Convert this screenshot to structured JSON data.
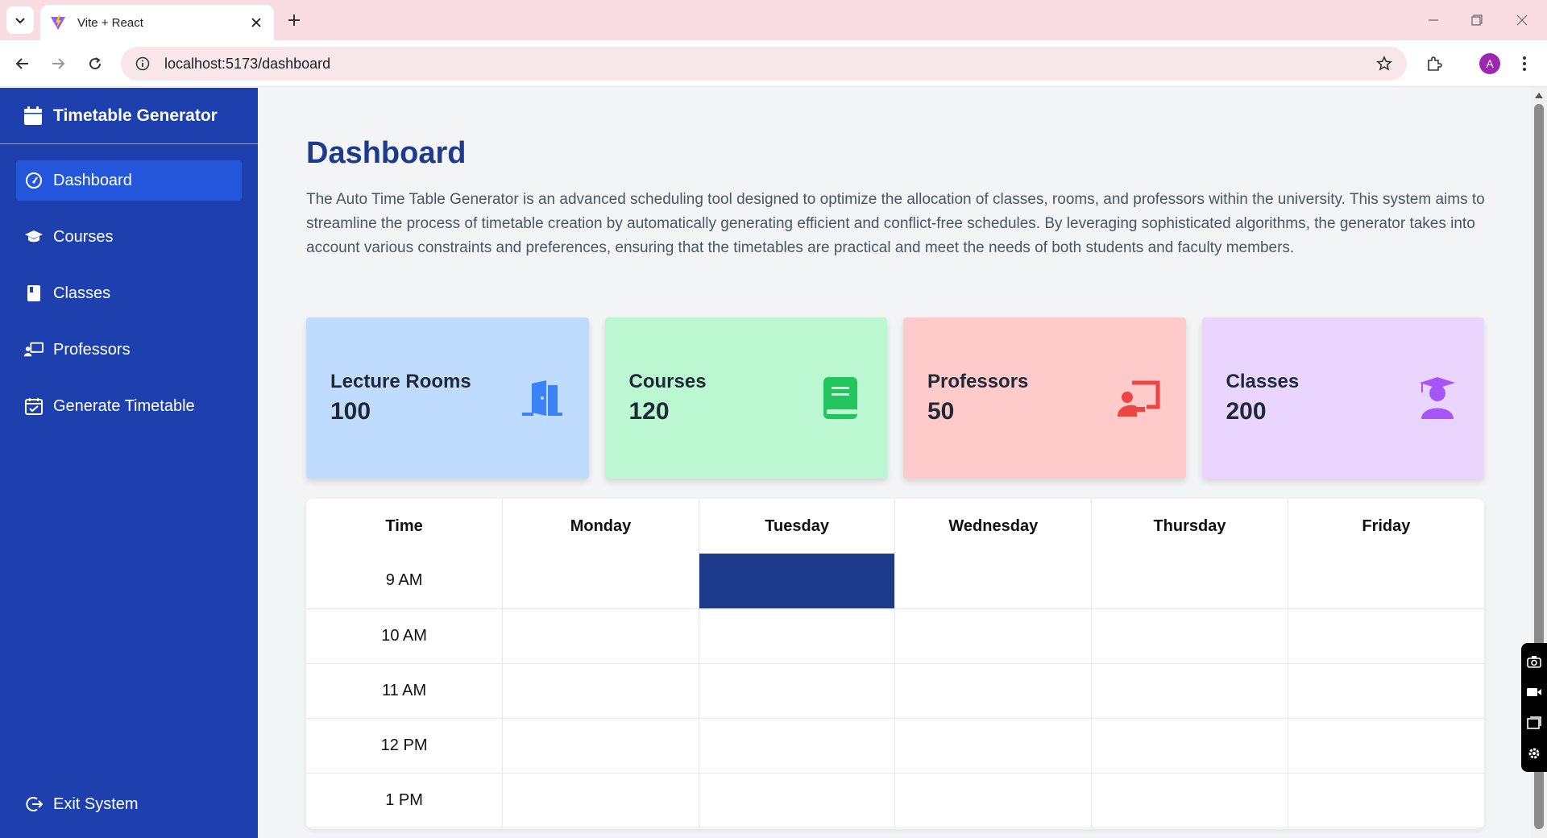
{
  "browser": {
    "tab_title": "Vite + React",
    "url": "localhost:5173/dashboard",
    "profile_initial": "A"
  },
  "sidebar": {
    "brand": "Timetable Generator",
    "items": [
      {
        "label": "Dashboard",
        "icon": "gauge-icon",
        "active": true
      },
      {
        "label": "Courses",
        "icon": "graduation-cap-icon",
        "active": false
      },
      {
        "label": "Classes",
        "icon": "book-icon",
        "active": false
      },
      {
        "label": "Professors",
        "icon": "chalkboard-teacher-icon",
        "active": false
      },
      {
        "label": "Generate Timetable",
        "icon": "calendar-check-icon",
        "active": false
      }
    ],
    "exit_label": "Exit System"
  },
  "main": {
    "title": "Dashboard",
    "intro": "The Auto Time Table Generator is an advanced scheduling tool designed to optimize the allocation of classes, rooms, and professors within the university. This system aims to streamline the process of timetable creation by automatically generating efficient and conflict-free schedules. By leveraging sophisticated algorithms, the generator takes into account various constraints and preferences, ensuring that the timetables are practical and meet the needs of both students and faculty members.",
    "cards": [
      {
        "label": "Lecture Rooms",
        "value": "100",
        "icon": "door-open-icon",
        "bg": "#bfdbfe",
        "icon_color": "#3b82f6"
      },
      {
        "label": "Courses",
        "value": "120",
        "icon": "book-icon",
        "bg": "#bbf7d0",
        "icon_color": "#22c55e"
      },
      {
        "label": "Professors",
        "value": "50",
        "icon": "chalkboard-teacher-icon",
        "bg": "#fecaca",
        "icon_color": "#ef4444"
      },
      {
        "label": "Classes",
        "value": "200",
        "icon": "user-graduate-icon",
        "bg": "#e9d5ff",
        "icon_color": "#a855f7"
      }
    ],
    "timetable": {
      "headers": [
        "Time",
        "Monday",
        "Tuesday",
        "Wednesday",
        "Thursday",
        "Friday"
      ],
      "rows": [
        {
          "time": "9 AM",
          "filled": [
            false,
            true,
            false,
            false,
            false
          ]
        },
        {
          "time": "10 AM",
          "filled": [
            false,
            false,
            false,
            false,
            false
          ]
        },
        {
          "time": "11 AM",
          "filled": [
            false,
            false,
            false,
            false,
            false
          ]
        },
        {
          "time": "12 PM",
          "filled": [
            false,
            false,
            false,
            false,
            false
          ]
        },
        {
          "time": "1 PM",
          "filled": [
            false,
            false,
            false,
            false,
            false
          ]
        }
      ],
      "filled_color": "#1e3a8a"
    }
  }
}
